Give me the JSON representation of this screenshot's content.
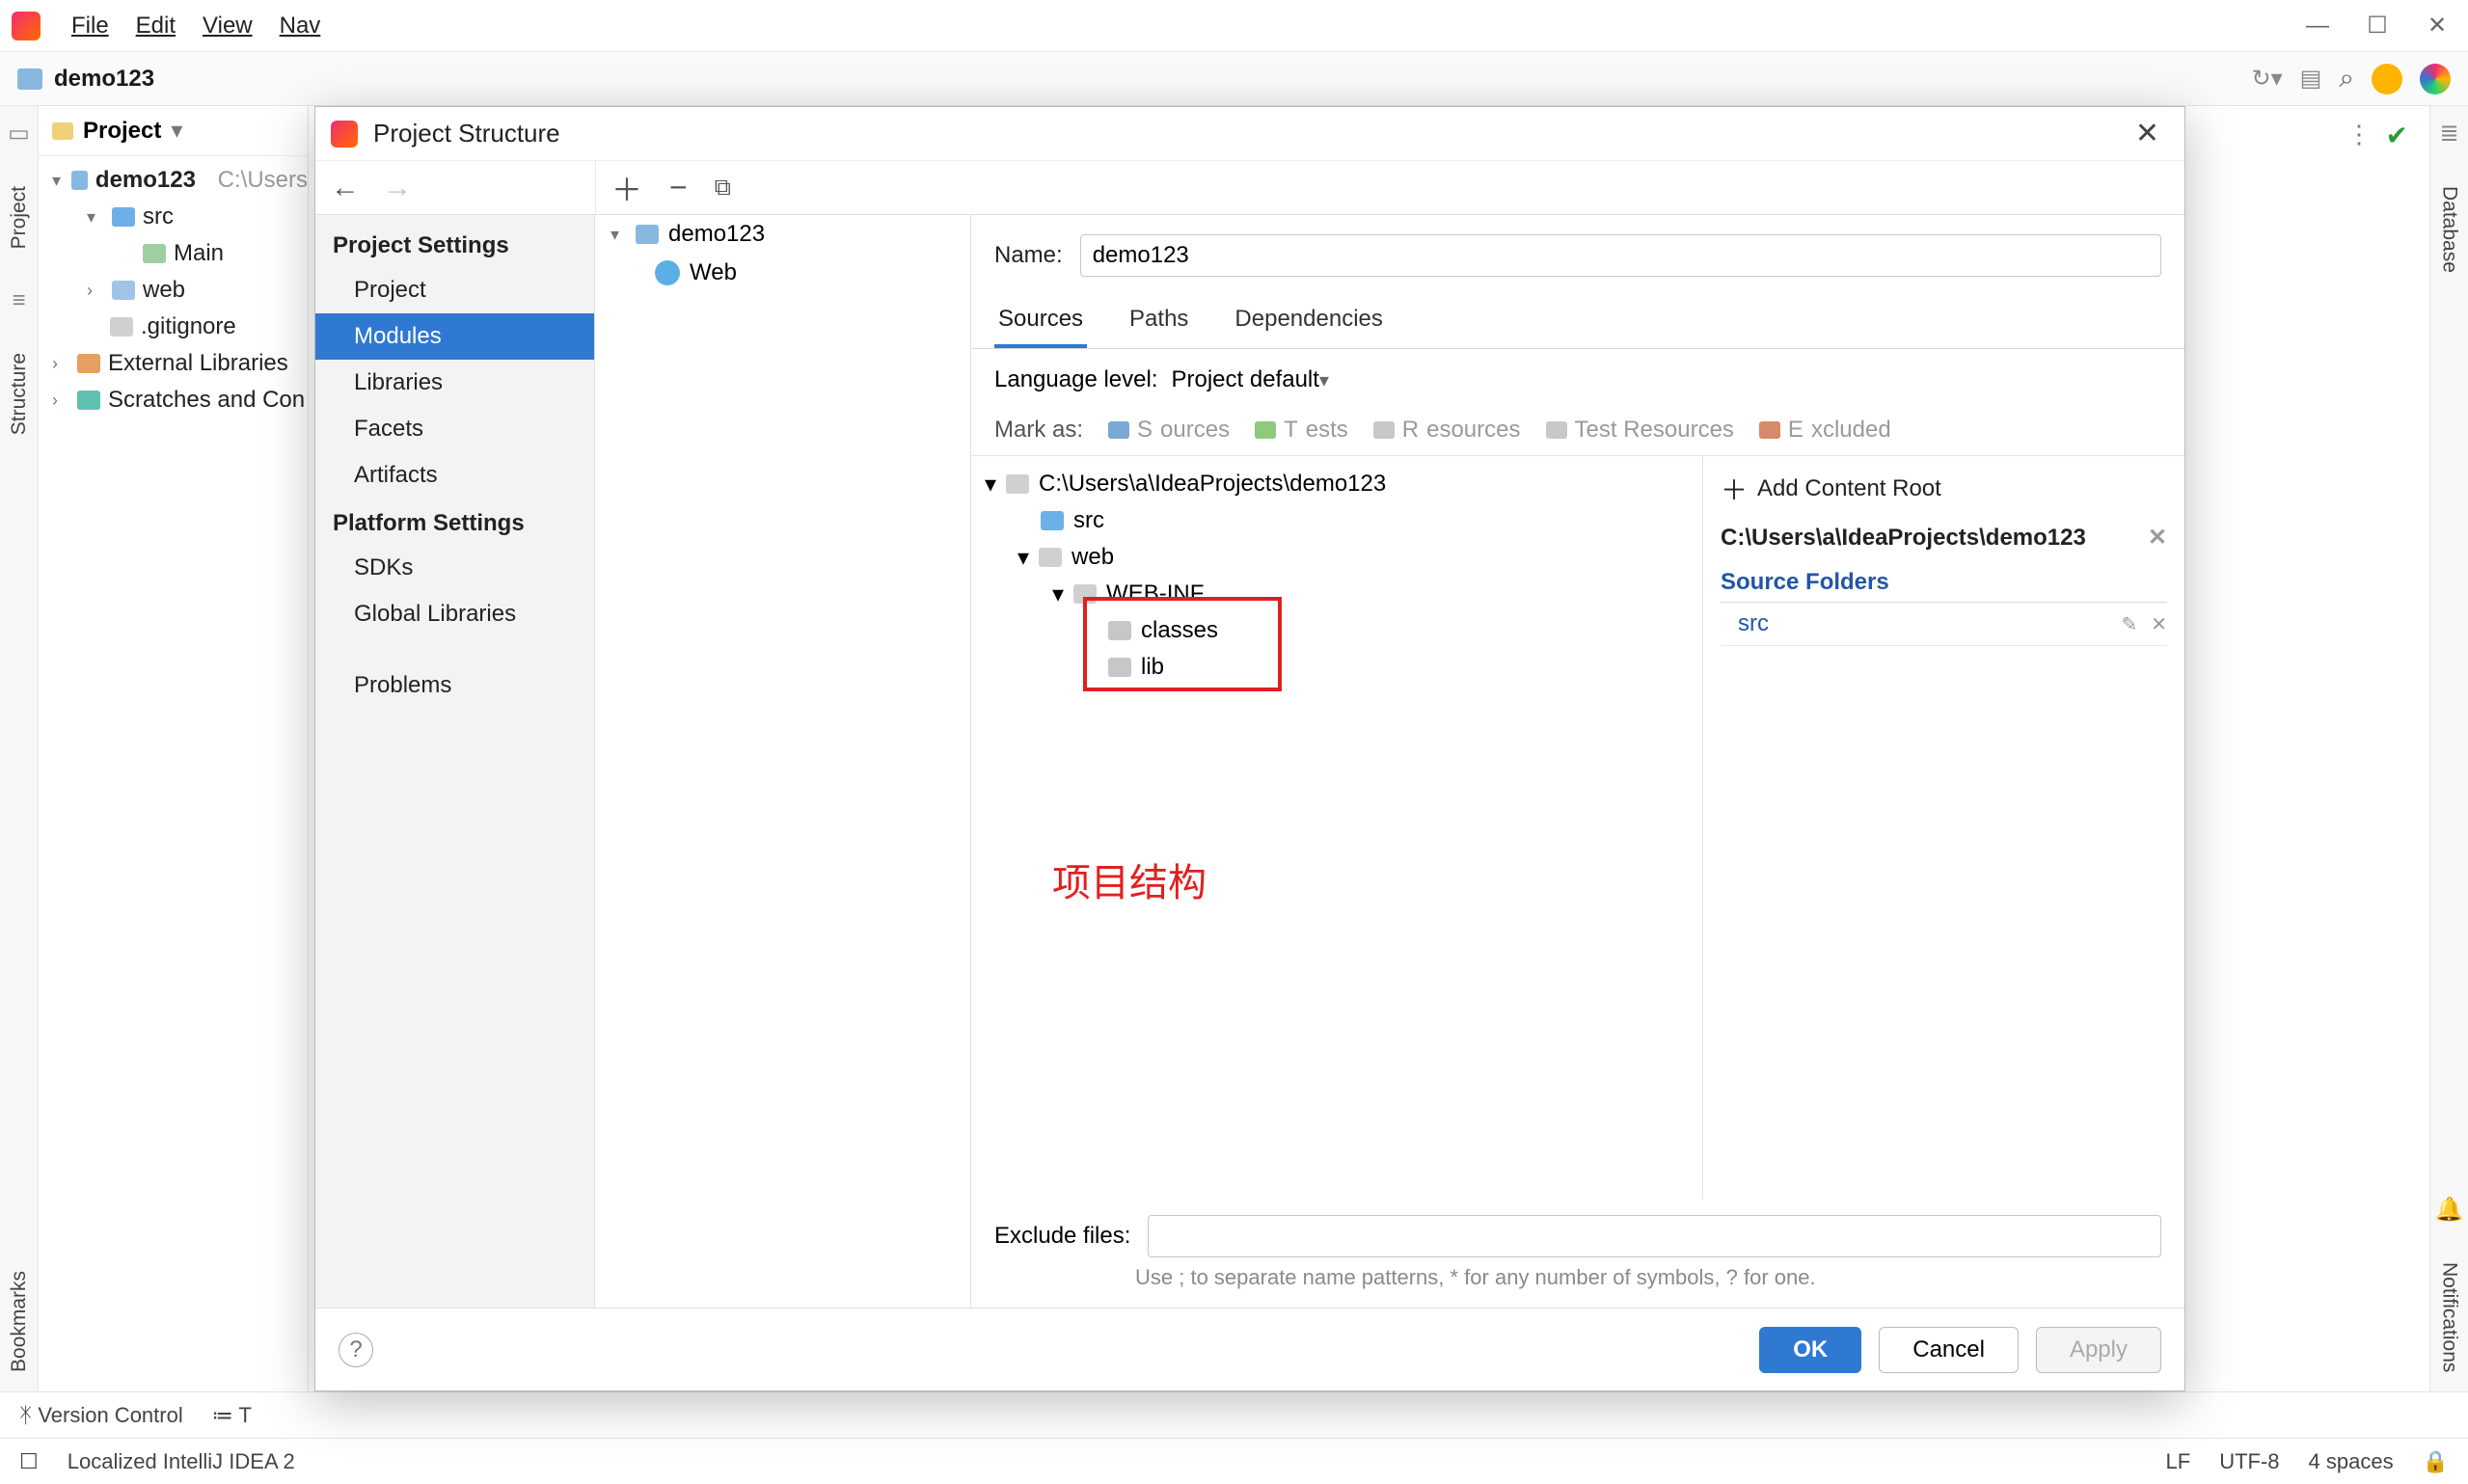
{
  "menubar": {
    "file": "File",
    "edit": "Edit",
    "view": "View",
    "nav": "Nav"
  },
  "navbar": {
    "project": "demo123"
  },
  "left_gutter": {
    "project": "Project",
    "structure": "Structure",
    "bookmarks": "Bookmarks"
  },
  "right_gutter": {
    "database": "Database",
    "notifications": "Notifications"
  },
  "project_panel": {
    "title": "Project",
    "root": "demo123",
    "root_suffix": "C:\\Users",
    "src": "src",
    "main": "Main",
    "web": "web",
    "gitignore": ".gitignore",
    "external": "External Libraries",
    "scratches": "Scratches and Con"
  },
  "status1": {
    "version_control": "Version Control",
    "todo": "T"
  },
  "status2": {
    "msg": "Localized IntelliJ IDEA 2",
    "lf": "LF",
    "enc": "UTF-8",
    "indent": "4 spaces"
  },
  "dialog": {
    "title": "Project Structure",
    "nav": {
      "project_settings": "Project Settings",
      "project": "Project",
      "modules": "Modules",
      "libraries": "Libraries",
      "facets": "Facets",
      "artifacts": "Artifacts",
      "platform_settings": "Platform Settings",
      "sdks": "SDKs",
      "global_libraries": "Global Libraries",
      "problems": "Problems"
    },
    "module_tree": {
      "root": "demo123",
      "web": "Web"
    },
    "name_label": "Name:",
    "name_value": "demo123",
    "tabs": {
      "sources": "Sources",
      "paths": "Paths",
      "deps": "Dependencies"
    },
    "lang_label": "Language level:",
    "lang_value": "Project default",
    "mark_as": "Mark as:",
    "marks": {
      "sources": "Sources",
      "tests": "Tests",
      "resources": "Resources",
      "test_resources": "Test Resources",
      "excluded": "Excluded"
    },
    "tree": {
      "root": "C:\\Users\\a\\IdeaProjects\\demo123",
      "src": "src",
      "web": "web",
      "webinf": "WEB-INF",
      "classes": "classes",
      "lib": "lib"
    },
    "annotation": "项目结构",
    "side": {
      "add": "Add Content Root",
      "path": "C:\\Users\\a\\IdeaProjects\\demo123",
      "source_folders": "Source Folders",
      "src": "src"
    },
    "exclude_label": "Exclude files:",
    "exclude_hint": "Use ; to separate name patterns, * for any number of symbols, ? for one.",
    "buttons": {
      "ok": "OK",
      "cancel": "Cancel",
      "apply": "Apply"
    }
  }
}
